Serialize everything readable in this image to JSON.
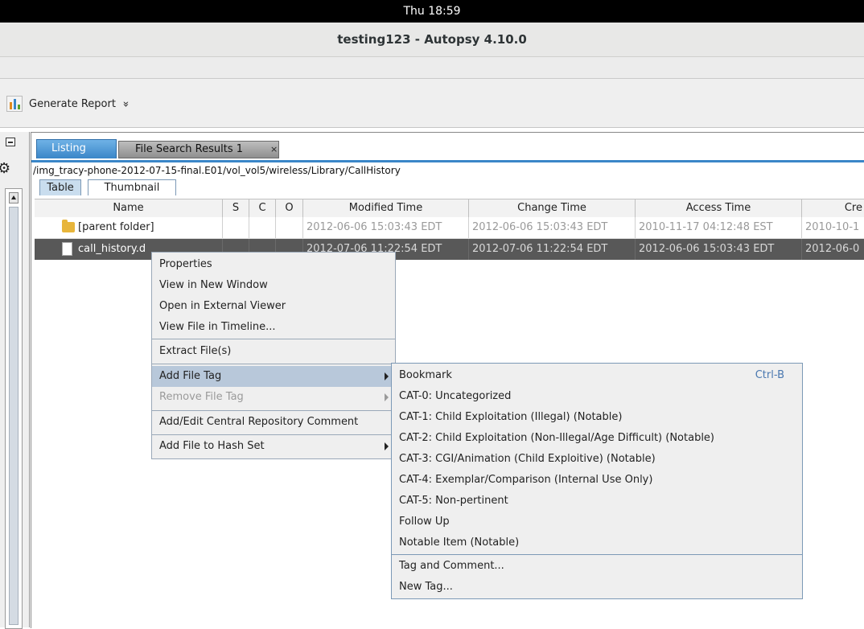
{
  "system": {
    "clock": "Thu 18:59"
  },
  "window": {
    "title": "testing123 - Autopsy 4.10.0"
  },
  "toolbar": {
    "generate_report_label": "Generate Report",
    "overflow_glyph": "»"
  },
  "tabs": [
    {
      "label": "Listing"
    },
    {
      "label": "File Search Results 1",
      "close_glyph": "×"
    }
  ],
  "breadcrumb": "/img_tracy-phone-2012-07-15-final.E01/vol_vol5/wireless/Library/CallHistory",
  "view_tabs": [
    "Table",
    "Thumbnail"
  ],
  "table": {
    "headers": [
      "Name",
      "S",
      "C",
      "O",
      "Modified Time",
      "Change Time",
      "Access Time",
      "Cre"
    ],
    "rows": [
      {
        "name": "[parent folder]",
        "modified": "2012-06-06 15:03:43 EDT",
        "changed": "2012-06-06 15:03:43 EDT",
        "accessed": "2010-11-17 04:12:48 EST",
        "created": "2010-10-1"
      },
      {
        "name": "call_history.d",
        "modified": "2012-07-06 11:22:54 EDT",
        "changed": "2012-07-06 11:22:54 EDT",
        "accessed": "2012-06-06 15:03:43 EDT",
        "created": "2012-06-0"
      }
    ]
  },
  "context_menu": {
    "items": [
      {
        "label": "Properties"
      },
      {
        "label": "View in New Window"
      },
      {
        "label": "Open in External Viewer"
      },
      {
        "label": "View File in Timeline..."
      },
      {
        "label": "Extract File(s)"
      },
      {
        "label": "Add File Tag"
      },
      {
        "label": "Remove File Tag"
      },
      {
        "label": "Add/Edit Central Repository Comment"
      },
      {
        "label": "Add File to Hash Set"
      }
    ]
  },
  "submenu": {
    "items": [
      {
        "label": "Bookmark",
        "shortcut": "Ctrl-B"
      },
      {
        "label": "CAT-0: Uncategorized"
      },
      {
        "label": "CAT-1: Child Exploitation (Illegal) (Notable)"
      },
      {
        "label": "CAT-2: Child Exploitation (Non-Illegal/Age Difficult) (Notable)"
      },
      {
        "label": "CAT-3: CGI/Animation (Child Exploitive) (Notable)"
      },
      {
        "label": "CAT-4: Exemplar/Comparison (Internal Use Only)"
      },
      {
        "label": "CAT-5: Non-pertinent"
      },
      {
        "label": "Follow Up"
      },
      {
        "label": "Notable Item (Notable)"
      },
      {
        "label": "Tag and Comment..."
      },
      {
        "label": "New Tag..."
      }
    ]
  },
  "colors": {
    "accent": "#3a86c8",
    "selected_row": "#585858",
    "menu_highlight": "#b8c8da"
  }
}
